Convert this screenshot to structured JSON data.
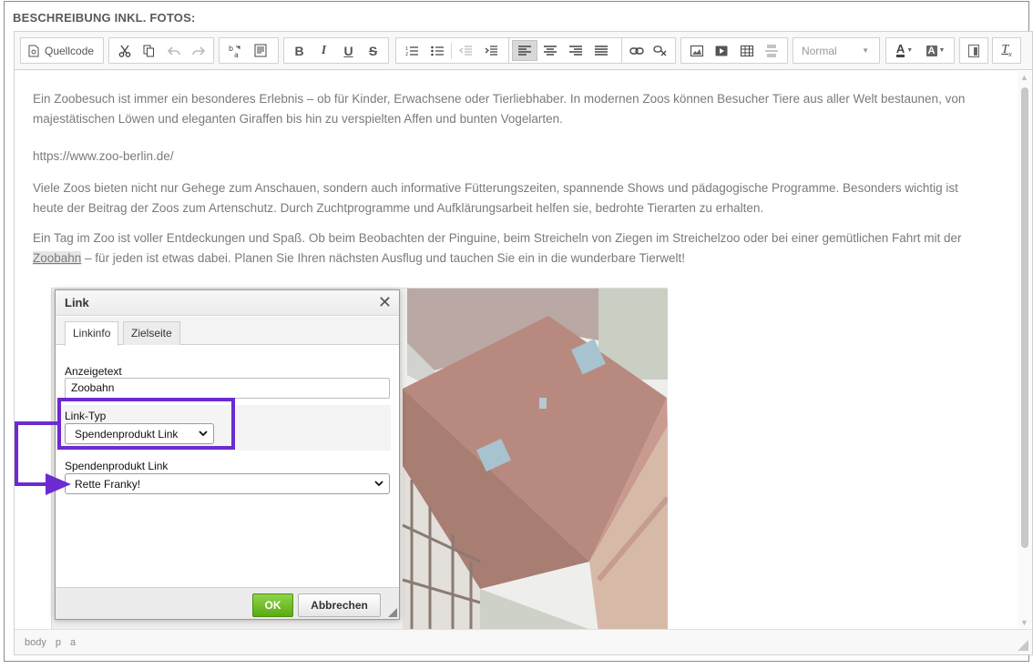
{
  "section": {
    "title": "BESCHREIBUNG INKL. FOTOS:"
  },
  "toolbar": {
    "source_label": "Quellcode",
    "format_value": "Normal",
    "icons": [
      "source-icon",
      "cut-icon",
      "copy-icon",
      "undo-icon",
      "redo-icon",
      "spellcheck-icon",
      "paste-text-icon",
      "bold-icon",
      "italic-icon",
      "underline-icon",
      "strikethrough-icon",
      "numbered-list-icon",
      "bulleted-list-icon",
      "outdent-icon",
      "indent-icon",
      "align-left-icon",
      "align-center-icon",
      "align-right-icon",
      "justify-icon",
      "link-icon",
      "unlink-icon",
      "image-icon",
      "video-icon",
      "table-icon",
      "horizontal-rule-icon",
      "text-color-icon",
      "background-color-icon",
      "show-blocks-icon",
      "remove-format-icon"
    ],
    "bold_glyph": "B",
    "italic_glyph": "I",
    "underline_glyph": "U",
    "strike_glyph": "S",
    "text_color_glyph": "A",
    "remove_format_glyph": "T"
  },
  "content": {
    "p1": "Ein Zoobesuch ist immer ein besonderes Erlebnis – ob für Kinder, Erwachsene oder Tierliebhaber. In modernen Zoos können Besucher Tiere aus aller Welt bestaunen, von majestätischen Löwen und eleganten Giraffen bis hin zu verspielten Affen und bunten Vogelarten.",
    "url": "https://www.zoo-berlin.de/",
    "p2": "Viele Zoos bieten nicht nur Gehege zum Anschauen, sondern auch informative Fütterungszeiten, spannende Shows und pädagogische Programme. Besonders wichtig ist heute der Beitrag der Zoos zum Artenschutz. Durch Zuchtprogramme und Aufklärungsarbeit helfen sie, bedrohte Tierarten zu erhalten.",
    "p3_start": "Ein Tag im Zoo ist voller Entdeckungen und Spaß. Ob beim Beobachten der Pinguine, beim Streicheln von Ziegen im Streichelzoo oder bei einer gemütlichen Fahrt mit der ",
    "p3_link": "Zoobahn",
    "p3_end": " – für jeden ist etwas dabei. Planen Sie Ihren nächsten Ausflug und tauchen Sie ein in die wunderbare Tierwelt!"
  },
  "statusbar": {
    "path": [
      "body",
      "p",
      "a"
    ]
  },
  "dialog": {
    "title": "Link",
    "close_glyph": "✕",
    "tabs": [
      "Linkinfo",
      "Zielseite"
    ],
    "display_text_label": "Anzeigetext",
    "display_text_value": "Zoobahn",
    "link_type_label": "Link-Typ",
    "link_type_value": "Spendenprodukt Link",
    "donation_label": "Spendenprodukt Link",
    "donation_value": "Rette Franky!",
    "ok_label": "OK",
    "cancel_label": "Abbrechen"
  },
  "colors": {
    "annotation": "#6b2bd1",
    "ok_button": "#6cbb1e"
  }
}
